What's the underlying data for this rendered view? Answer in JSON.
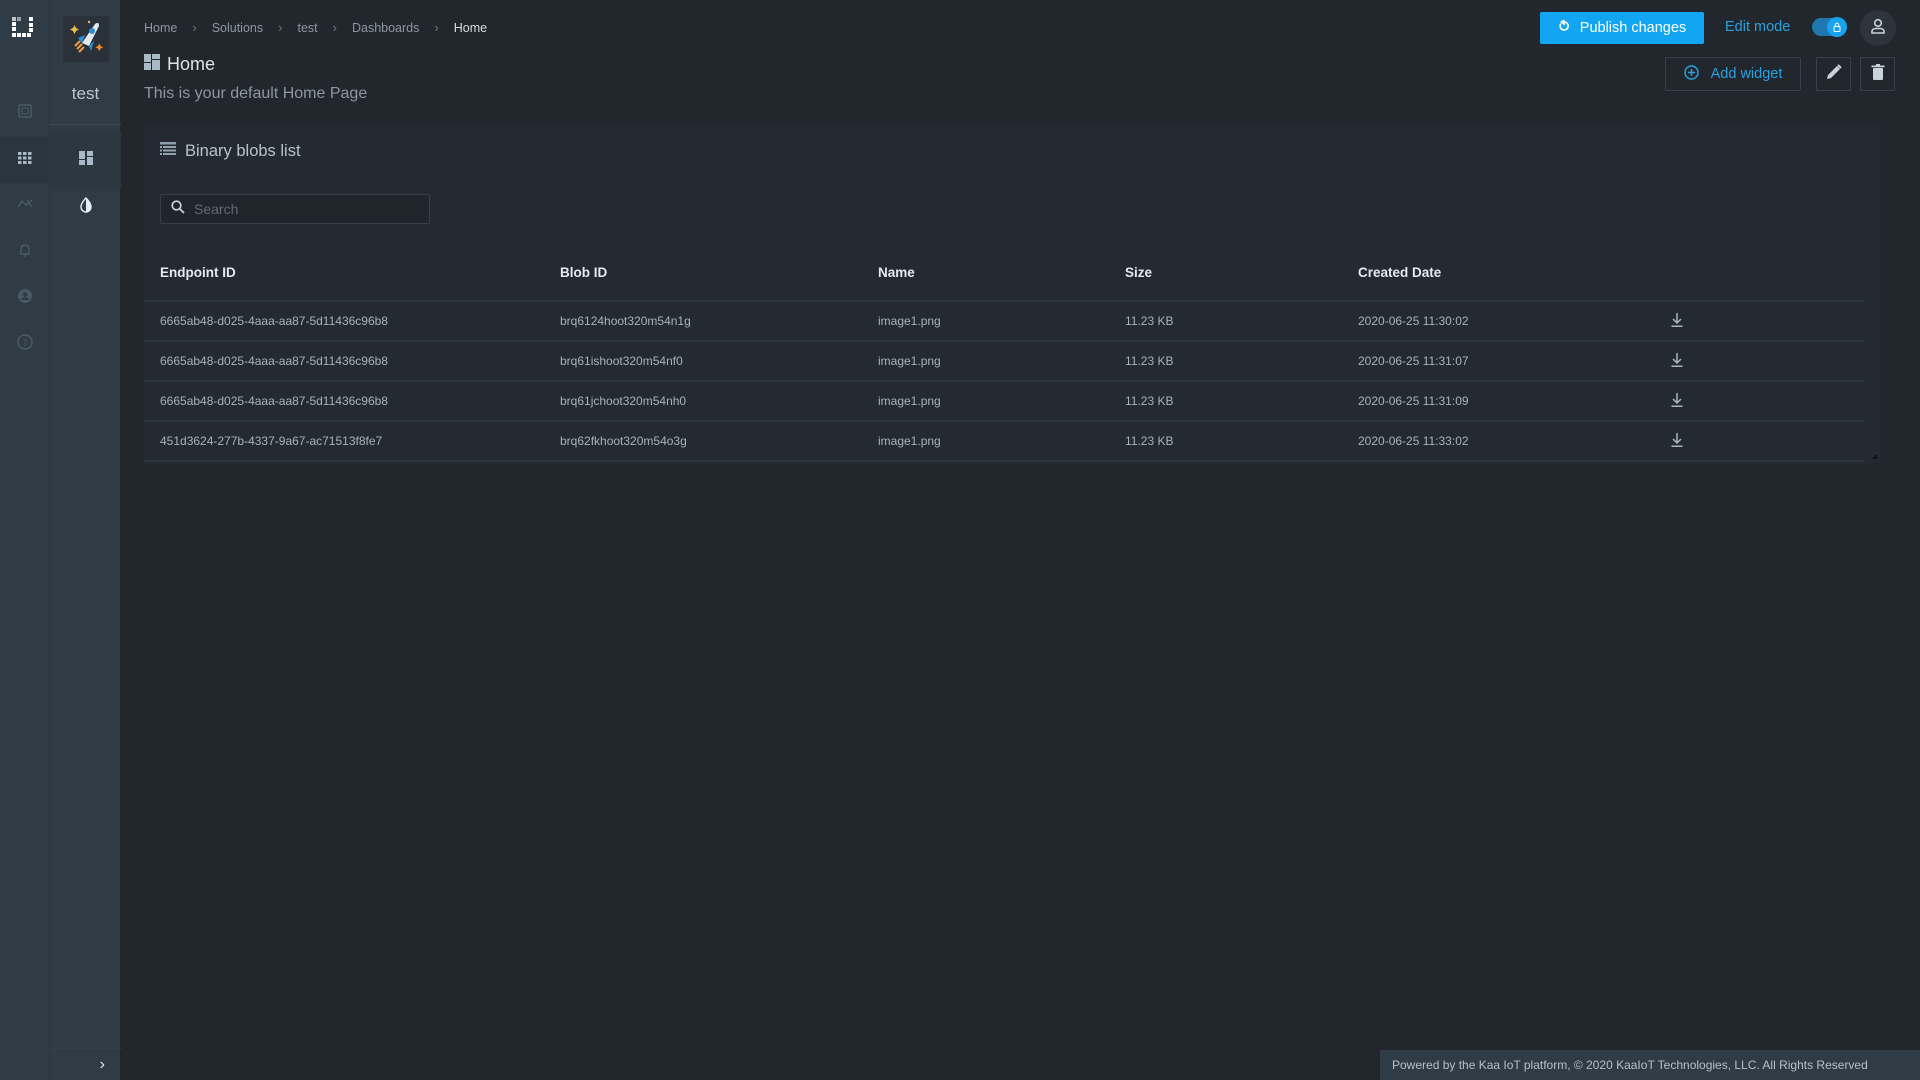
{
  "rail": {
    "items": [
      {
        "name": "devices",
        "icon": "device-icon",
        "active": false
      },
      {
        "name": "solutions",
        "icon": "apps-grid-icon",
        "active": true
      },
      {
        "name": "analytics",
        "icon": "trend-icon",
        "active": false
      },
      {
        "name": "alerts",
        "icon": "bell-icon",
        "active": false
      },
      {
        "name": "account",
        "icon": "account-icon",
        "active": false
      },
      {
        "name": "help",
        "icon": "help-icon",
        "active": false
      }
    ]
  },
  "sidebar": {
    "app_name": "test",
    "items": [
      {
        "name": "dashboards",
        "icon": "dashboard-icon",
        "active": true
      },
      {
        "name": "theme",
        "icon": "contrast-icon",
        "active": false
      }
    ],
    "collapse_glyph": "›"
  },
  "breadcrumb": {
    "items": [
      "Home",
      "Solutions",
      "test",
      "Dashboards",
      "Home"
    ],
    "separator": "›"
  },
  "header": {
    "title": "Home",
    "subtitle": "This is your default Home Page",
    "publish_label": "Publish changes",
    "edit_mode_label": "Edit mode",
    "edit_mode_on": true,
    "add_widget_label": "Add widget"
  },
  "colors": {
    "accent": "#12a6f2",
    "link": "#2aa0e0",
    "background": "#22272d",
    "sidebar": "#2f3c45",
    "card": "#232a31"
  },
  "widget": {
    "title": "Binary blobs list",
    "search_placeholder": "Search",
    "search_value": "",
    "columns": [
      "Endpoint ID",
      "Blob ID",
      "Name",
      "Size",
      "Created Date",
      ""
    ],
    "rows": [
      {
        "endpoint_id": "6665ab48-d025-4aaa-aa87-5d11436c96b8",
        "blob_id": "brq6124hoot320m54n1g",
        "name": "image1.png",
        "size": "11.23 KB",
        "created": "2020-06-25 11:30:02"
      },
      {
        "endpoint_id": "6665ab48-d025-4aaa-aa87-5d11436c96b8",
        "blob_id": "brq61ishoot320m54nf0",
        "name": "image1.png",
        "size": "11.23 KB",
        "created": "2020-06-25 11:31:07"
      },
      {
        "endpoint_id": "6665ab48-d025-4aaa-aa87-5d11436c96b8",
        "blob_id": "brq61jchoot320m54nh0",
        "name": "image1.png",
        "size": "11.23 KB",
        "created": "2020-06-25 11:31:09"
      },
      {
        "endpoint_id": "451d3624-277b-4337-9a67-ac71513f8fe7",
        "blob_id": "brq62fkhoot320m54o3g",
        "name": "image1.png",
        "size": "11.23 KB",
        "created": "2020-06-25 11:33:02"
      }
    ]
  },
  "footer": {
    "text": "Powered by the Kaa IoT platform, © 2020 KaaIoT Technologies, LLC. All Rights Reserved"
  }
}
